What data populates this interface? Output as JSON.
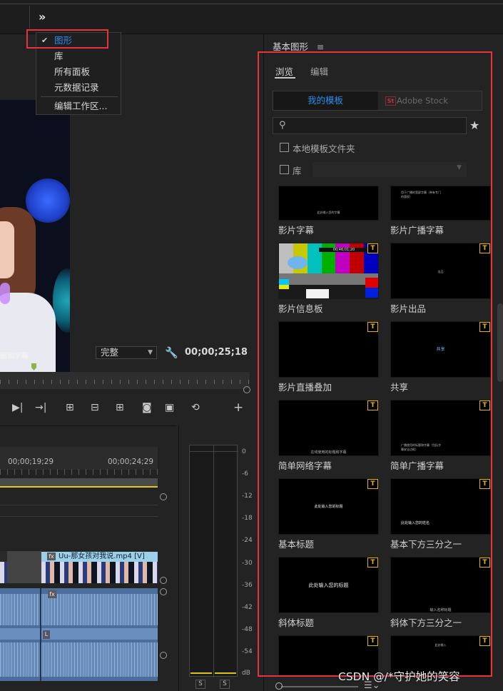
{
  "top": {
    "chevron": "»"
  },
  "menu": {
    "items": [
      {
        "label": "图形",
        "checked": true
      },
      {
        "label": "库",
        "checked": false
      },
      {
        "label": "所有面板",
        "checked": false
      },
      {
        "label": "元数据记录",
        "checked": false
      },
      {
        "label": "编辑工作区...",
        "checked": false
      }
    ],
    "check_glyph": "✔"
  },
  "monitor": {
    "video_caption": "题和字幕",
    "quality": "完整",
    "timecode": "00;00;25;18",
    "icons": [
      "step-forward-icon",
      "go-to-out-icon",
      "lift-icon",
      "extract-icon",
      "insert-icon",
      "camera-icon",
      "compare-icon",
      "loop-icon",
      "add-icon"
    ]
  },
  "timeline": {
    "timecodes": [
      "00;00;19;29",
      "00;00;24;29"
    ],
    "clip_label": "Uu-那女孩对我说.mp4 [V]",
    "fx": "fx",
    "audio_marker": "L"
  },
  "meter": {
    "db_labels": [
      "0",
      "-6",
      "-12",
      "-18",
      "-24",
      "-30",
      "-36",
      "-42",
      "-48",
      "-54",
      "dB"
    ],
    "solo": "S"
  },
  "panel": {
    "title": "基本图形",
    "title_icon": "≡",
    "tabs": [
      "浏览",
      "编辑"
    ],
    "segments": {
      "mine": "我的模板",
      "stock": "Adobe Stock",
      "stock_logo": "St"
    },
    "search": {
      "placeholder": "",
      "value": ""
    },
    "local_folder_label": "本地模板文件夹",
    "library_label": "库",
    "library_value": "",
    "badge": "T",
    "templates": [
      {
        "label": "影片字幕",
        "thumb_text": "此处输入您的字幕",
        "badge": false
      },
      {
        "label": "影片广播字幕",
        "thumb_text": "用于广播的宽屏字幕（带有专门的版权）",
        "badge": false
      },
      {
        "label": "影片信息板",
        "thumb_text": "00;46;01;20",
        "badge": true
      },
      {
        "label": "影片出品",
        "thumb_text": "出品",
        "badge": true
      },
      {
        "label": "影片直播叠加",
        "thumb_text": "",
        "badge": true
      },
      {
        "label": "共享",
        "thumb_text": "共享",
        "badge": true
      },
      {
        "label": "简单网络字幕",
        "thumb_text": "在线使用的标题和字幕",
        "badge": true
      },
      {
        "label": "简单广播字幕",
        "thumb_text": "广播使用的标题和字幕（包括字幕安全边框）",
        "badge": true
      },
      {
        "label": "基本标题",
        "thumb_text": "此处输入您的标题",
        "badge": true
      },
      {
        "label": "基本下方三分之一",
        "thumb_text": "此处输入您的姓名",
        "badge": true
      },
      {
        "label": "斜体标题",
        "thumb_text": "此处输入您的标题",
        "badge": true
      },
      {
        "label": "斜体下方三分之一",
        "thumb_text": "输入名称标题",
        "badge": true
      },
      {
        "label": "",
        "thumb_text": "",
        "badge": true
      },
      {
        "label": "",
        "thumb_text": "此处输入",
        "badge": true
      }
    ],
    "colors": {
      "accent": "#2d8ceb",
      "highlight_box": "#e8323c",
      "badge": "#e7b400"
    }
  },
  "footer": {
    "list_icon": "☰⌄"
  },
  "watermark": "CSDN @/*守护她的笑容"
}
